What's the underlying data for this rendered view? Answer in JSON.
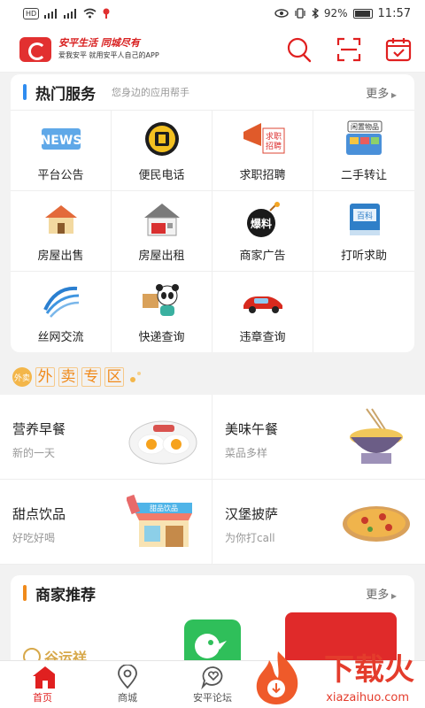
{
  "status": {
    "battery": "92%",
    "time": "11:57",
    "hd": "HD"
  },
  "appbar": {
    "slogan": "安平生活 同城尽有",
    "sub_slogan": "爱我安平  就用安平人自己的APP"
  },
  "hot": {
    "title": "热门服务",
    "subtitle": "您身边的应用帮手",
    "more": "更多",
    "items": [
      {
        "label": "平台公告",
        "icon": "news-icon"
      },
      {
        "label": "便民电话",
        "icon": "phone-icon"
      },
      {
        "label": "求职招聘",
        "icon": "megaphone-icon",
        "icon_text": "求职招聘"
      },
      {
        "label": "二手转让",
        "icon": "secondhand-icon",
        "icon_text": "闲置物品"
      },
      {
        "label": "房屋出售",
        "icon": "house-icon"
      },
      {
        "label": "房屋出租",
        "icon": "rent-house-icon"
      },
      {
        "label": "商家广告",
        "icon": "bomb-icon",
        "icon_text": "爆料"
      },
      {
        "label": "打听求助",
        "icon": "book-icon",
        "icon_text": "百科"
      },
      {
        "label": "丝网交流",
        "icon": "wave-icon"
      },
      {
        "label": "快递查询",
        "icon": "panda-delivery-icon"
      },
      {
        "label": "违章查询",
        "icon": "car-icon"
      }
    ]
  },
  "waimai": {
    "badge": "外卖",
    "chars": [
      "外",
      "卖",
      "专",
      "区"
    ],
    "items": [
      {
        "title": "营养早餐",
        "sub": "新的一天",
        "pic": "breakfast-image"
      },
      {
        "title": "美味午餐",
        "sub": "菜品多样",
        "pic": "noodle-image"
      },
      {
        "title": "甜点饮品",
        "sub": "好吃好喝",
        "pic": "dessert-shop-image",
        "pic_text": "甜品饮品"
      },
      {
        "title": "汉堡披萨",
        "sub": "为你打call",
        "pic": "pizza-image"
      }
    ]
  },
  "merchant": {
    "title": "商家推荐",
    "more": "更多",
    "partial_text": "谷运祥"
  },
  "tabs": [
    {
      "label": "首页",
      "icon": "home-icon"
    },
    {
      "label": "商城",
      "icon": "map-pin-icon"
    },
    {
      "label": "安平论坛",
      "icon": "heart-chat-icon"
    }
  ],
  "watermark": {
    "brand": "下载火",
    "url": "xiazaihuo.com"
  },
  "colors": {
    "accent": "#e02020",
    "orange": "#f08a1b",
    "blue_mark": "#2f8cf0"
  }
}
